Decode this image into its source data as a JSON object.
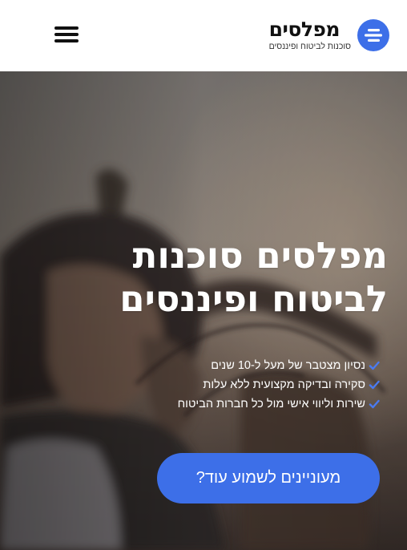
{
  "header": {
    "logo_name": "מפלסים",
    "logo_tagline": "סוכנות לביטוח ופיננסים",
    "menu_icon": "hamburger-menu-icon",
    "logo_icon": "mefalsim-logo-icon"
  },
  "hero": {
    "title_line1": "מפלסים סוכנות",
    "title_line2": "לביטוח ופיננסים",
    "features": [
      "נסיון מצטבר של מעל ל-10 שנים",
      "סקירה ובדיקה מקצועית ללא עלות",
      "שירות וליווי אישי מול כל חברות הביטוח"
    ],
    "feature_icon": "check-icon",
    "cta_label": "מעוניינים לשמוע עוד?",
    "background_image": "people-outdoors-photo"
  },
  "colors": {
    "accent": "#3d6fe8",
    "check": "#4a7af0",
    "text_dark": "#111111",
    "header_bg": "#ffffff"
  }
}
